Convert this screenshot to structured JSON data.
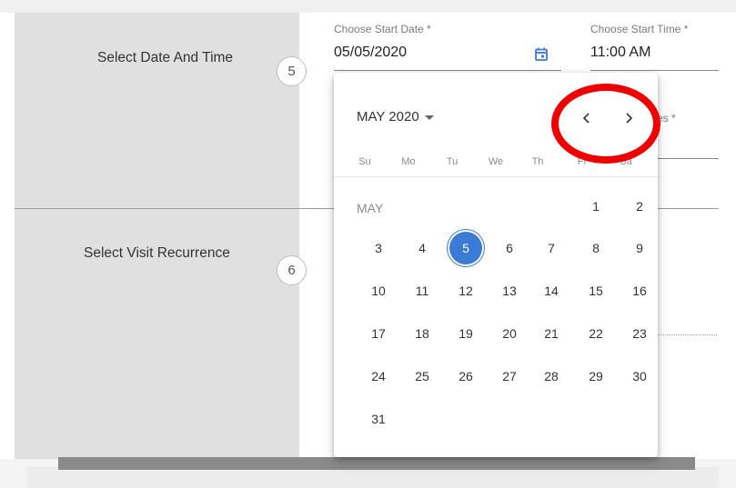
{
  "sections": [
    {
      "label": "Select Date And Time",
      "step": "5"
    },
    {
      "label": "Select Visit Recurrence",
      "step": "6"
    }
  ],
  "fields": {
    "start_date": {
      "label": "Choose Start Date *",
      "value": "05/05/2020"
    },
    "start_time": {
      "label": "Choose Start Time *",
      "value": "11:00 AM"
    },
    "duration_partial_label": "utes *"
  },
  "calendar": {
    "month_year": "MAY 2020",
    "month_label": "MAY",
    "weekdays": [
      "Su",
      "Mo",
      "Tu",
      "We",
      "Th",
      "Fr",
      "Sa"
    ],
    "weeks": [
      [
        "",
        "",
        "",
        "",
        "",
        "1",
        "2"
      ],
      [
        "3",
        "4",
        "5",
        "6",
        "7",
        "8",
        "9"
      ],
      [
        "10",
        "11",
        "12",
        "13",
        "14",
        "15",
        "16"
      ],
      [
        "17",
        "18",
        "19",
        "20",
        "21",
        "22",
        "23"
      ],
      [
        "24",
        "25",
        "26",
        "27",
        "28",
        "29",
        "30"
      ],
      [
        "31",
        "",
        "",
        "",
        "",
        "",
        ""
      ]
    ],
    "selected_day": "5",
    "accent_color": "#3a7bd5",
    "prev_icon": "chevron-left-icon",
    "next_icon": "chevron-right-icon"
  },
  "annotation": {
    "color": "#ee0000"
  }
}
